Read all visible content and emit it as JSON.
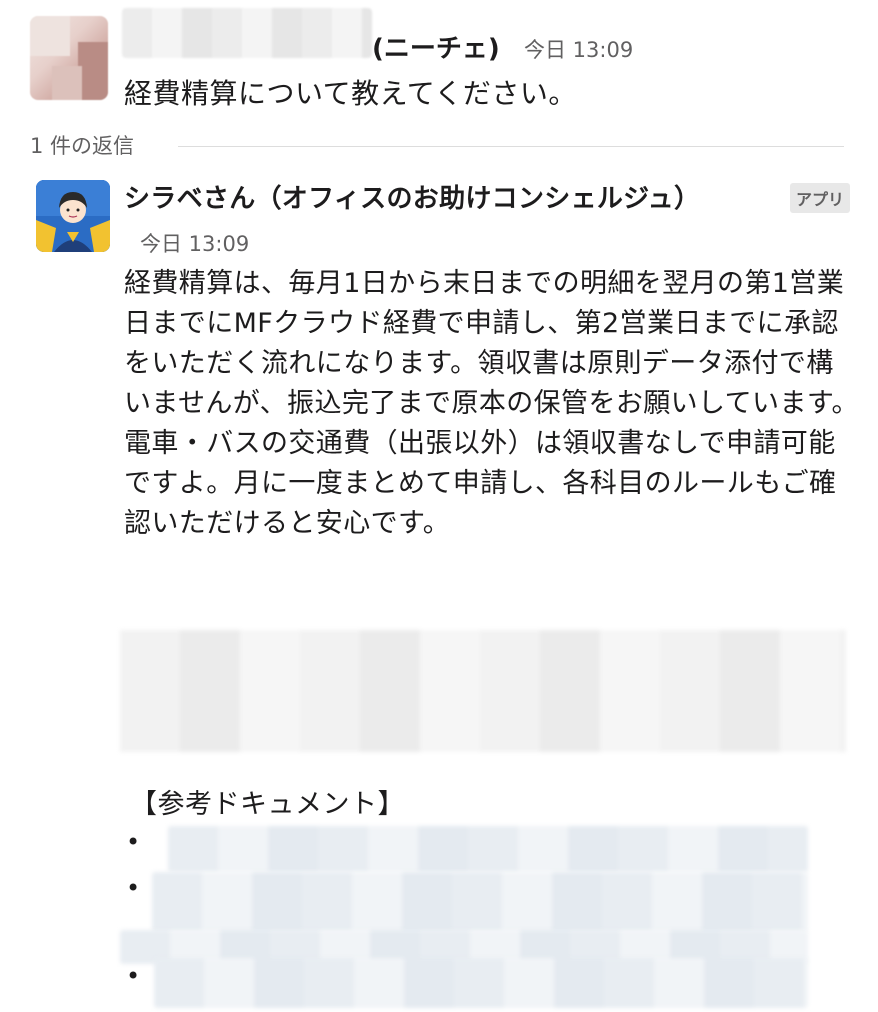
{
  "user_message": {
    "name_suffix": "(ニーチェ)",
    "timestamp": "今日 13:09",
    "text": "経費精算について教えてください。"
  },
  "thread": {
    "reply_count": "1 件の返信"
  },
  "bot_message": {
    "name": "シラベさん（オフィスのお助けコンシェルジュ）",
    "badge": "アプリ",
    "timestamp": "今日 13:09",
    "text": "経費精算は、毎月1日から末日までの明細を翌月の第1営業日までにMFクラウド経費で申請し、第2営業日までに承認をいただく流れになります。領収書は原則データ添付で構いませんが、振込完了まで原本の保管をお願いしています。電車・バスの交通費（出張以外）は領収書なしで申請可能ですよ。月に一度まとめて申請し、各科目のルールもご確認いただけると安心です。",
    "references_title": "【参考ドキュメント】",
    "bullet": "•"
  },
  "colors": {
    "text": "#1d1c1d",
    "muted": "#616061",
    "bot_avatar_bg": "#2b6cc4",
    "bot_avatar_accent": "#f2c230"
  }
}
